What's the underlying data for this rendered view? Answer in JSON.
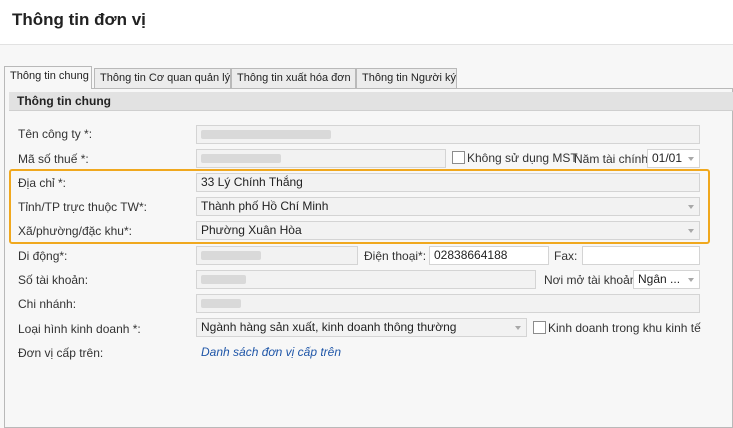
{
  "page": {
    "title": "Thông tin đơn vị"
  },
  "tabs": [
    {
      "label": "Thông tin chung"
    },
    {
      "label": "Thông tin Cơ quan quản lý"
    },
    {
      "label": "Thông tin xuất hóa đơn"
    },
    {
      "label": "Thông tin Người ký"
    }
  ],
  "section": {
    "title": "Thông tin chung"
  },
  "form": {
    "company_name": {
      "label": "Tên công ty *:",
      "value": ""
    },
    "tax_code": {
      "label": "Mã số thuế *:",
      "value": ""
    },
    "no_tax_code": {
      "label": "Không sử dụng MST",
      "checked": false
    },
    "fiscal_year": {
      "label": "Năm tài chính:",
      "value": "01/01"
    },
    "address": {
      "label": "Địa chỉ *:",
      "value": "33 Lý Chính Thắng"
    },
    "province": {
      "label": "Tỉnh/TP trực thuộc TW*:",
      "value": "Thành phố Hồ Chí Minh"
    },
    "ward": {
      "label": "Xã/phường/đặc khu*:",
      "value": "Phường Xuân Hòa"
    },
    "mobile": {
      "label": "Di động*:",
      "value": ""
    },
    "phone": {
      "label": "Điện thoại*:",
      "value": "02838664188"
    },
    "fax": {
      "label": "Fax:",
      "value": ""
    },
    "account_number": {
      "label": "Số tài khoản:",
      "value": ""
    },
    "bank": {
      "label": "Nơi mở tài khoản:",
      "value": "Ngân ..."
    },
    "branch": {
      "label": "Chi nhánh:",
      "value": ""
    },
    "business_type": {
      "label": "Loại hình kinh doanh *:",
      "value": "Ngành hàng sản xuất, kinh doanh thông thường"
    },
    "economic_zone": {
      "label": "Kinh doanh trong khu kinh tế",
      "checked": false
    },
    "parent_unit": {
      "label": "Đơn vị cấp trên:",
      "link": "Danh sách đơn vị cấp trên"
    }
  },
  "colors": {
    "highlight": "#f0a81e",
    "link": "#1f56a8"
  },
  "icons": {
    "dropdown": "chevron-down-icon",
    "checkbox": "checkbox-icon"
  }
}
